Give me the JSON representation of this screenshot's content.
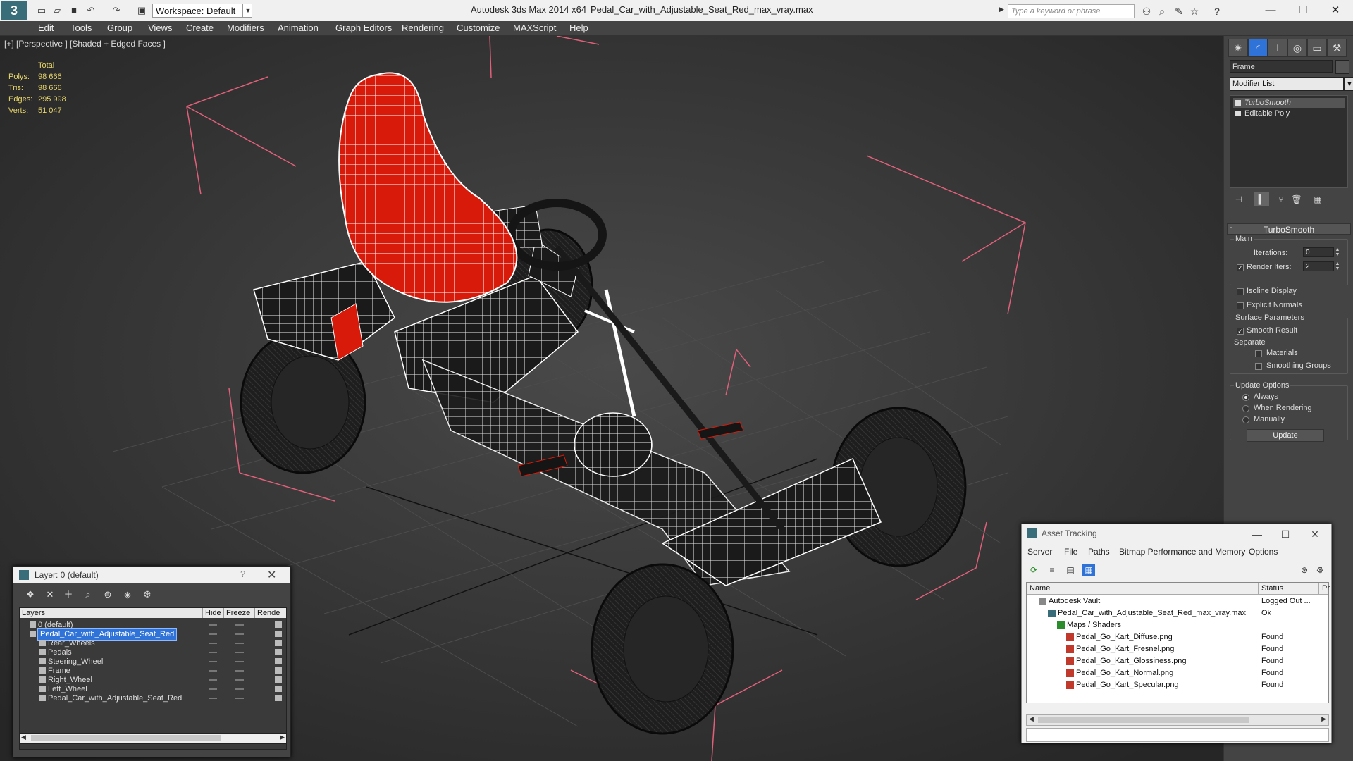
{
  "titlebar": {
    "workspace": "Workspace: Default",
    "app_title": "Autodesk 3ds Max  2014 x64",
    "file_title": "Pedal_Car_with_Adjustable_Seat_Red_max_vray.max",
    "search_placeholder": "Type a keyword or phrase"
  },
  "menu": [
    "Edit",
    "Tools",
    "Group",
    "Views",
    "Create",
    "Modifiers",
    "Animation",
    "Graph Editors",
    "Rendering",
    "Customize",
    "MAXScript",
    "Help"
  ],
  "viewport": {
    "label": "[+] [Perspective ] [Shaded + Edged Faces ]",
    "stats_header": "Total",
    "stats": [
      {
        "label": "Polys:",
        "value": "98 666"
      },
      {
        "label": "Tris:",
        "value": "98 666"
      },
      {
        "label": "Edges:",
        "value": "295 998"
      },
      {
        "label": "Verts:",
        "value": "51 047"
      }
    ]
  },
  "command_panel": {
    "object_name": "Frame",
    "modifier_list": "Modifier List",
    "stack": [
      "TurboSmooth",
      "Editable Poly"
    ],
    "rollout_title": "TurboSmooth",
    "main_group": "Main",
    "iterations_label": "Iterations:",
    "iterations_value": "0",
    "render_iters_label": "Render Iters:",
    "render_iters_value": "2",
    "isoline_label": "Isoline Display",
    "explicit_normals_label": "Explicit Normals",
    "surface_group": "Surface Parameters",
    "smooth_result_label": "Smooth Result",
    "separate_label": "Separate",
    "materials_label": "Materials",
    "smoothing_groups_label": "Smoothing Groups",
    "update_group": "Update Options",
    "always_label": "Always",
    "when_rendering_label": "When Rendering",
    "manually_label": "Manually",
    "update_button": "Update"
  },
  "layer_panel": {
    "title": "Layer: 0 (default)",
    "help": "?",
    "columns": [
      "Layers",
      "Hide",
      "Freeze",
      "Rende"
    ],
    "rows": [
      {
        "name": "0 (default)",
        "indent": 0,
        "selected": false
      },
      {
        "name": "Pedal_Car_with_Adjustable_Seat_Red",
        "indent": 0,
        "selected": true
      },
      {
        "name": "Rear_Wheels",
        "indent": 1,
        "selected": false
      },
      {
        "name": "Pedals",
        "indent": 1,
        "selected": false
      },
      {
        "name": "Steering_Wheel",
        "indent": 1,
        "selected": false
      },
      {
        "name": "Frame",
        "indent": 1,
        "selected": false
      },
      {
        "name": "Right_Wheel",
        "indent": 1,
        "selected": false
      },
      {
        "name": "Left_Wheel",
        "indent": 1,
        "selected": false
      },
      {
        "name": "Pedal_Car_with_Adjustable_Seat_Red",
        "indent": 1,
        "selected": false
      }
    ]
  },
  "asset_tracking": {
    "title": "Asset Tracking",
    "menu": [
      "Server",
      "File",
      "Paths",
      "Bitmap Performance and Memory",
      "Options"
    ],
    "columns": [
      "Name",
      "Status",
      "Pr"
    ],
    "rows": [
      {
        "name": "Autodesk Vault",
        "status": "Logged Out ...",
        "indent": 1
      },
      {
        "name": "Pedal_Car_with_Adjustable_Seat_Red_max_vray.max",
        "status": "Ok",
        "indent": 2
      },
      {
        "name": "Maps / Shaders",
        "status": "",
        "indent": 3
      },
      {
        "name": "Pedal_Go_Kart_Diffuse.png",
        "status": "Found",
        "indent": 4
      },
      {
        "name": "Pedal_Go_Kart_Fresnel.png",
        "status": "Found",
        "indent": 4
      },
      {
        "name": "Pedal_Go_Kart_Glossiness.png",
        "status": "Found",
        "indent": 4
      },
      {
        "name": "Pedal_Go_Kart_Normal.png",
        "status": "Found",
        "indent": 4
      },
      {
        "name": "Pedal_Go_Kart_Specular.png",
        "status": "Found",
        "indent": 4
      }
    ]
  },
  "colors": {
    "seat_red": "#d81a0a",
    "selection_blue": "#2f73d8",
    "stats_yellow": "#e8d66a",
    "bbox_pink": "#e0607a"
  }
}
